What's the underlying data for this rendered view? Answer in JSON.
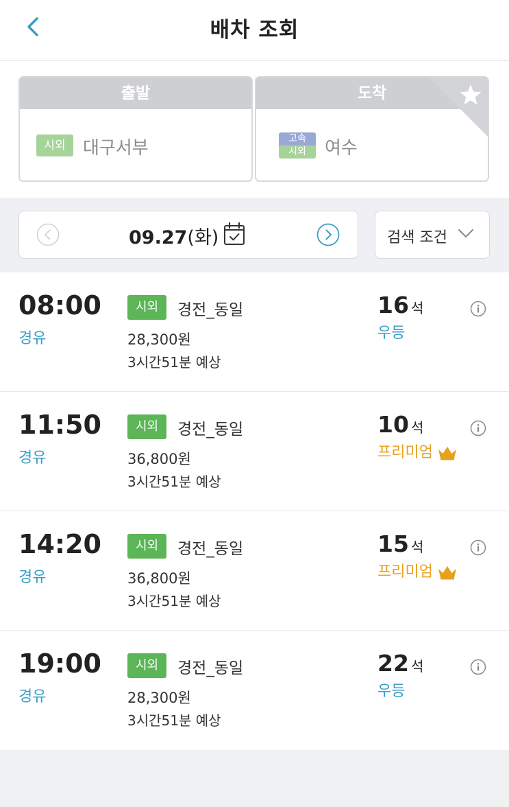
{
  "header": {
    "title": "배차 조회"
  },
  "route": {
    "departure": {
      "header_label": "출발",
      "badge": "시외",
      "terminal": "대구서부"
    },
    "arrival": {
      "header_label": "도착",
      "badge_top": "고속",
      "badge_bottom": "시외",
      "terminal": "여수"
    }
  },
  "date_bar": {
    "date": "09.27",
    "weekday": "(화)",
    "filter_label": "검색 조건"
  },
  "schedules": [
    {
      "time": "08:00",
      "via": "경유",
      "type": "시외",
      "company": "경전_동일",
      "fare": "28,300원",
      "duration": "3시간51분 예상",
      "seats": "16",
      "seat_unit": "석",
      "grade": "우등",
      "grade_kind": "basic"
    },
    {
      "time": "11:50",
      "via": "경유",
      "type": "시외",
      "company": "경전_동일",
      "fare": "36,800원",
      "duration": "3시간51분 예상",
      "seats": "10",
      "seat_unit": "석",
      "grade": "프리미엄",
      "grade_kind": "premium"
    },
    {
      "time": "14:20",
      "via": "경유",
      "type": "시외",
      "company": "경전_동일",
      "fare": "36,800원",
      "duration": "3시간51분 예상",
      "seats": "15",
      "seat_unit": "석",
      "grade": "프리미엄",
      "grade_kind": "premium"
    },
    {
      "time": "19:00",
      "via": "경유",
      "type": "시외",
      "company": "경전_동일",
      "fare": "28,300원",
      "duration": "3시간51분 예상",
      "seats": "22",
      "seat_unit": "석",
      "grade": "우등",
      "grade_kind": "basic"
    }
  ],
  "colors": {
    "accent_blue": "#3b9fc4",
    "premium_orange": "#e8a11c",
    "bus_green": "#5cb557"
  },
  "icons": {
    "back": "chevron-left-icon",
    "favorite": "star-icon",
    "prev_date": "circle-chevron-left-icon",
    "next_date": "circle-chevron-right-icon",
    "calendar": "calendar-check-icon",
    "filter": "chevron-down-icon",
    "info": "info-icon",
    "premium": "crown-icon"
  }
}
